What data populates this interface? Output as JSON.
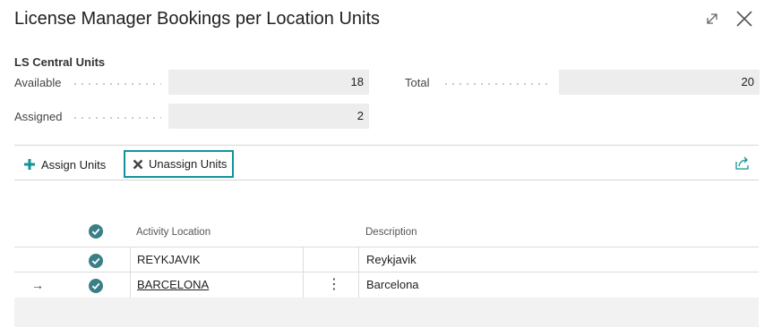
{
  "window": {
    "title": "License Manager Bookings per Location Units"
  },
  "fasttab": {
    "title": "LS Central Units",
    "available_label": "Available",
    "available_value": "18",
    "total_label": "Total",
    "total_value": "20",
    "assigned_label": "Assigned",
    "assigned_value": "2"
  },
  "toolbar": {
    "assign_label": "Assign Units",
    "unassign_label": "Unassign Units"
  },
  "grid": {
    "columns": {
      "location": "Activity Location",
      "description": "Description"
    },
    "rows": [
      {
        "location": "REYKJAVIK",
        "description": "Reykjavik"
      },
      {
        "location": "BARCELONA",
        "description": "Barcelona"
      }
    ],
    "selected_marker": "→",
    "row_menu": "⋮"
  },
  "colors": {
    "accent": "#12939a",
    "check": "#3a7f86"
  }
}
